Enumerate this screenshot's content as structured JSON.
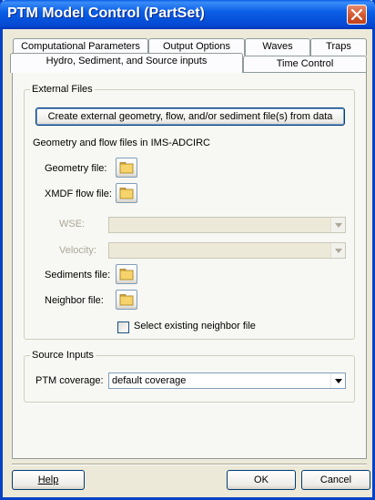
{
  "window": {
    "title": "PTM Model Control (PartSet)"
  },
  "tabs": {
    "row1": [
      {
        "label": "Computational Parameters"
      },
      {
        "label": "Output Options"
      },
      {
        "label": "Waves"
      },
      {
        "label": "Traps"
      }
    ],
    "row2": [
      {
        "label": "Hydro, Sediment, and Source inputs"
      },
      {
        "label": "Time Control"
      }
    ],
    "active": "Hydro, Sediment, and Source inputs"
  },
  "external_files": {
    "group_label": "External Files",
    "create_button_label": "Create external geometry, flow, and/or sediment file(s) from data",
    "section_caption": "Geometry and flow files in IMS-ADCIRC",
    "geometry_label": "Geometry file:",
    "xmdf_label": "XMDF flow file:",
    "wse_label": "WSE:",
    "velocity_label": "Velocity:",
    "sediments_label": "Sediments file:",
    "neighbor_label": "Neighbor file:",
    "select_neighbor_label": "Select existing neighbor file",
    "select_neighbor_checked": false
  },
  "source_inputs": {
    "group_label": "Source Inputs",
    "coverage_label": "PTM coverage:",
    "coverage_value": "default coverage"
  },
  "footer": {
    "help_label": "Help",
    "ok_label": "OK",
    "cancel_label": "Cancel"
  },
  "colors": {
    "titlebar": "#0b5fe6",
    "dialog_bg": "#ece9d8",
    "close_button": "#d55a34"
  }
}
